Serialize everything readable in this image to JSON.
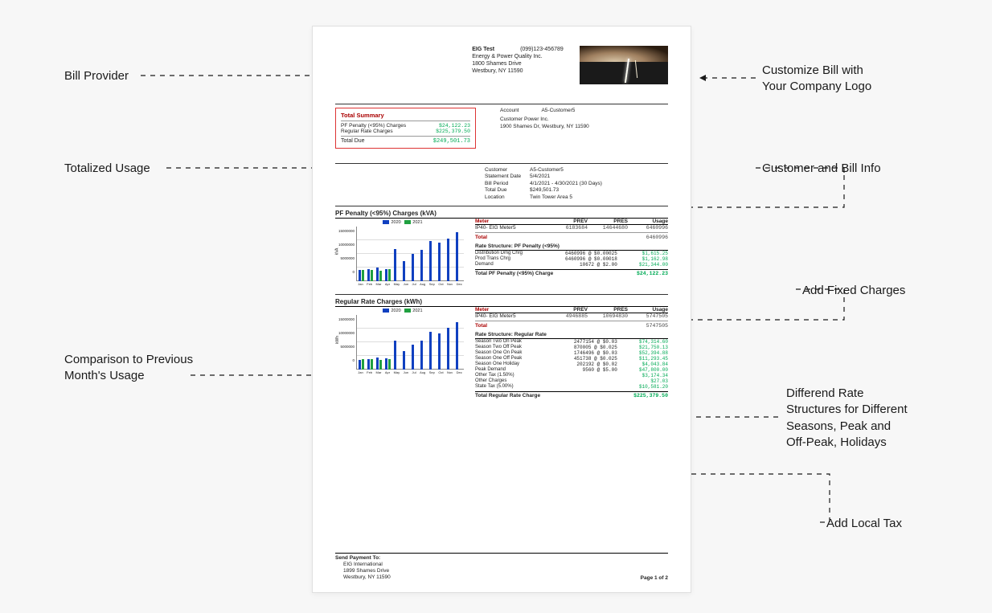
{
  "callouts": {
    "bill_provider": "Bill Provider",
    "totalized_usage": "Totalized Usage",
    "comparison": "Comparison to Previous\nMonth's Usage",
    "customize_logo": "Customize Bill with\nYour Company Logo",
    "customer_bill_info": "Customer and Bill Info",
    "add_fixed": "Add Fixed Charges",
    "rate_structures": "Differend Rate\nStructures for Different\nSeasons, Peak and\nOff-Peak, Holidays",
    "add_tax": "Add Local Tax"
  },
  "provider": {
    "name": "EIG Test",
    "company": "Energy & Power Quality Inc.",
    "addr1": "1800 Shames Drive",
    "addr2": "Westbury, NY 11590",
    "phone": "(099)123-456789"
  },
  "summary": {
    "title": "Total Summary",
    "l1_label": "PF Penalty (<95%) Charges",
    "l1_amt": "$24,122.23",
    "l2_label": "Regular Rate Charges",
    "l2_amt": "$225,379.50",
    "td_label": "Total Due",
    "td_amt": "$249,501.73"
  },
  "account": {
    "label": "Account",
    "id": "A5-Customer5",
    "company": "Customer Power Inc.",
    "addr": "1900 Shames Dr, Westbury, NY 11590"
  },
  "info": {
    "customer_k": "Customer",
    "customer_v": "A5-Customer5",
    "stmt_k": "Statement Date",
    "stmt_v": "5/4/2021",
    "period_k": "Bill Period",
    "period_v": "4/1/2021 - 4/30/2021 (30 Days)",
    "due_k": "Total Due",
    "due_v": "$249,501.73",
    "loc_k": "Location",
    "loc_v": "Twin Tower Area 5"
  },
  "chart_legend": {
    "y2020": "2020",
    "y2021": "2021"
  },
  "months": [
    "Jan",
    "Feb",
    "Mar",
    "Apr",
    "May",
    "Jun",
    "Jul",
    "Aug",
    "Sep",
    "Oct",
    "Nov",
    "Dec"
  ],
  "pf_section": {
    "title": "PF Penalty (<95%) Charges (kVA)",
    "ylabel": "kVA",
    "hdr_meter": "Meter",
    "hdr_prev": "PREV",
    "hdr_pres": "PRES",
    "hdr_usage": "Usage",
    "meter_name": "IP40- EIG Meter5",
    "prev": "6183684",
    "pres": "14644680",
    "usage": "6460996",
    "total_label": "Total",
    "total_usage": "6460996",
    "rs_title": "Rate Structure:   PF Penalty (<95%)",
    "lines": [
      {
        "n": "Distribution Dmg Chrg",
        "r": "6460996 @ $0.00025",
        "a": "$1,615.25"
      },
      {
        "n": "Prod Trans Chrg",
        "r": "6460996 @ $0.00018",
        "a": "$1,162.98"
      },
      {
        "n": "Demand",
        "r": "10672 @ $2.00",
        "a": "$21,344.00"
      }
    ],
    "tot_label": "Total PF Penalty (<95%) Charge",
    "tot_amt": "$24,122.23"
  },
  "reg_section": {
    "title": "Regular Rate Charges (kWh)",
    "ylabel": "kWh",
    "hdr_meter": "Meter",
    "hdr_prev": "PREV",
    "hdr_pres": "PRES",
    "hdr_usage": "Usage",
    "meter_name": "IP40- EIG Meter5",
    "prev": "4946885",
    "pres": "10694830",
    "usage": "5747505",
    "total_label": "Total",
    "total_usage": "5747505",
    "rs_title": "Rate Structure:   Regular Rate",
    "lines": [
      {
        "n": "Season Two On Peak",
        "r": "2477154 @ $0.03",
        "a": "$74,314.60"
      },
      {
        "n": "Season Two Off Peak",
        "r": "870005 @ $0.025",
        "a": "$21,750.13"
      },
      {
        "n": "Season One On Peak",
        "r": "1746496 @ $0.03",
        "a": "$52,394.88"
      },
      {
        "n": "Season One Off Peak",
        "r": "451738 @ $0.025",
        "a": "$11,293.45"
      },
      {
        "n": "Season One Holiday",
        "r": "202192 @ $0.02",
        "a": "$4,043.84"
      },
      {
        "n": "Peak Demand",
        "r": "9560 @ $5.00",
        "a": "$47,800.00"
      },
      {
        "n": "Other Tax (1.50%)",
        "r": "",
        "a": "$3,174.34"
      },
      {
        "n": "Other Charges",
        "r": "",
        "a": "$27.03"
      },
      {
        "n": "State Tax (5.00%)",
        "r": "",
        "a": "$10,581.20"
      }
    ],
    "tot_label": "Total Regular Rate Charge",
    "tot_amt": "$225,379.50"
  },
  "footer": {
    "title": "Send Payment To:",
    "l1": "EIG International",
    "l2": "1899 Shames Drive",
    "l3": "Westbury, NY 11590",
    "page": "Page 1 of 2"
  },
  "chart_data": [
    {
      "type": "bar",
      "title": "PF Penalty (<95%) Charges (kVA)",
      "ylabel": "kVA",
      "ylim": [
        0,
        15000000
      ],
      "yticks": [
        0,
        5000000,
        10000000,
        15000000
      ],
      "categories": [
        "Jan",
        "Feb",
        "Mar",
        "Apr",
        "May",
        "Jun",
        "Jul",
        "Aug",
        "Sep",
        "Oct",
        "Nov",
        "Dec"
      ],
      "series": [
        {
          "name": "2020",
          "color": "#1040c0",
          "values": [
            3200000,
            3400000,
            3800000,
            3500000,
            9200000,
            5800000,
            7800000,
            9000000,
            11500000,
            11000000,
            12200000,
            13800000
          ]
        },
        {
          "name": "2021",
          "color": "#20a040",
          "values": [
            3300000,
            3200000,
            3000000,
            3400000,
            0,
            0,
            0,
            0,
            0,
            0,
            0,
            0
          ]
        }
      ]
    },
    {
      "type": "bar",
      "title": "Regular Rate Charges (kWh)",
      "ylabel": "kWh",
      "ylim": [
        0,
        15000000
      ],
      "yticks": [
        0,
        5000000,
        10000000,
        15000000
      ],
      "categories": [
        "Jan",
        "Feb",
        "Mar",
        "Apr",
        "May",
        "Jun",
        "Jul",
        "Aug",
        "Sep",
        "Oct",
        "Nov",
        "Dec"
      ],
      "series": [
        {
          "name": "2020",
          "color": "#1040c0",
          "values": [
            2800000,
            2900000,
            3400000,
            3300000,
            8200000,
            5200000,
            7200000,
            8200000,
            10800000,
            10200000,
            11800000,
            13400000
          ]
        },
        {
          "name": "2021",
          "color": "#20a040",
          "values": [
            2900000,
            2900000,
            2700000,
            2900000,
            0,
            0,
            0,
            0,
            0,
            0,
            0,
            0
          ]
        }
      ]
    }
  ]
}
